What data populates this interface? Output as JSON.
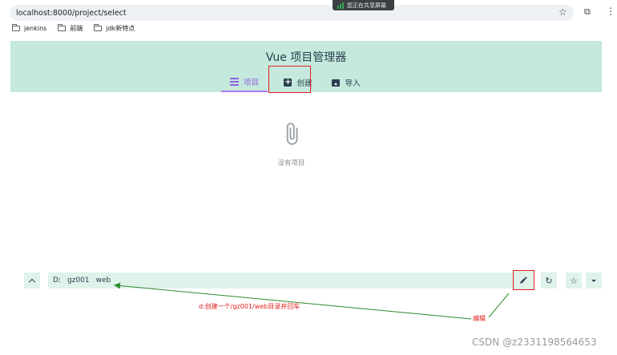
{
  "browser": {
    "url": "localhost:8000/project/select",
    "share_banner": "您正在共享屏幕",
    "bookmarks": [
      "jenkins",
      "前端",
      "jdk新特点"
    ]
  },
  "app": {
    "title": "Vue 项目管理器",
    "tabs": [
      {
        "label": "项目",
        "icon": "list-icon",
        "active": true
      },
      {
        "label": "创建",
        "icon": "plus-box-icon",
        "active": false
      },
      {
        "label": "导入",
        "icon": "import-icon",
        "active": false
      }
    ],
    "empty_state": {
      "icon": "paperclip-icon",
      "text": "没有项目"
    }
  },
  "path_bar": {
    "segments": [
      "D:",
      "gz001",
      "web"
    ],
    "buttons": [
      "chevron-up-icon",
      "pencil-icon",
      "refresh-icon",
      "star-icon",
      "caret-down-icon"
    ]
  },
  "annotations": {
    "create_note": "d:创建一个/gz001/web目录并回车",
    "edit_note": "编辑",
    "color": "#e02020"
  },
  "watermark": "CSDN @z2331198564653",
  "colors": {
    "header_bg": "#c5e9dc",
    "accent_purple": "#8e5fe0",
    "bar_bg": "#dff3ea",
    "arrow_green": "#2e8b2e"
  }
}
